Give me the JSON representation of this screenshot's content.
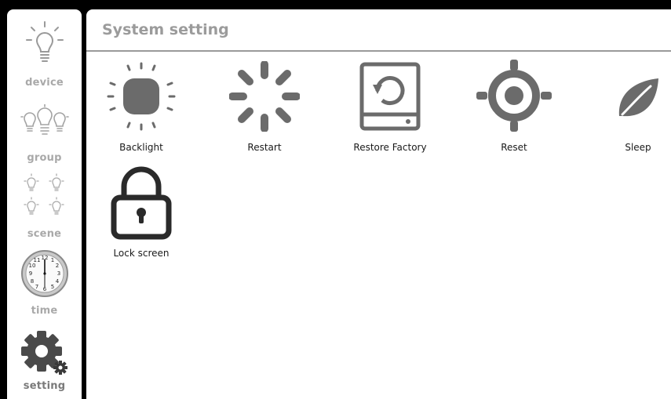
{
  "sidebar": {
    "items": [
      {
        "label": "device",
        "icon": "bulb-icon"
      },
      {
        "label": "group",
        "icon": "bulb-group-icon"
      },
      {
        "label": "scene",
        "icon": "scene-bulbs-icon"
      },
      {
        "label": "time",
        "icon": "clock-icon"
      },
      {
        "label": "setting",
        "icon": "gear-icon",
        "active": true
      }
    ]
  },
  "header": {
    "title": "System setting"
  },
  "settings": {
    "tiles": [
      {
        "label": "Backlight",
        "icon": "backlight-icon"
      },
      {
        "label": "Restart",
        "icon": "restart-spinner-icon"
      },
      {
        "label": "Restore Factory",
        "icon": "restore-factory-icon"
      },
      {
        "label": "Reset",
        "icon": "reset-target-icon"
      },
      {
        "label": "Sleep",
        "icon": "leaf-icon"
      },
      {
        "label": "Lock screen",
        "icon": "padlock-icon"
      }
    ]
  },
  "colors": {
    "background": "#000000",
    "panel": "#ffffff",
    "icon_gray": "#6e6e6e",
    "label_gray": "#a9a9a9"
  }
}
